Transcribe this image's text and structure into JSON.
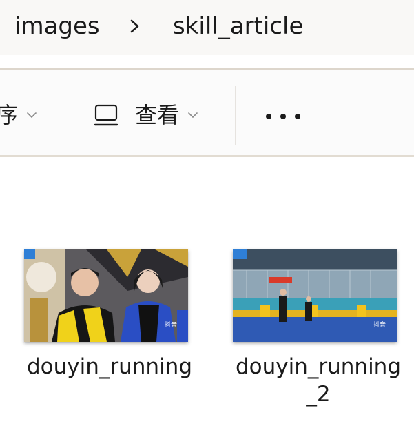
{
  "breadcrumb": {
    "items": [
      "images",
      "skill_article"
    ],
    "separator_icon": "chevron-right-icon"
  },
  "toolbar": {
    "sort_label": "序",
    "view_label": "查看",
    "view_icon": "monitor-icon",
    "more_icon": "more-horizontal-icon"
  },
  "files": [
    {
      "name": "douyin_running",
      "thumb_scene": "studio-guests-with-scarves"
    },
    {
      "name": "douyin_running\n_2",
      "thumb_scene": "indoor-pool-stage"
    }
  ],
  "colors": {
    "address_bg": "#f9f8f6",
    "toolbar_bg": "#fbfbfb",
    "text": "#1b1b1b",
    "divider": "#ddd6cc"
  }
}
